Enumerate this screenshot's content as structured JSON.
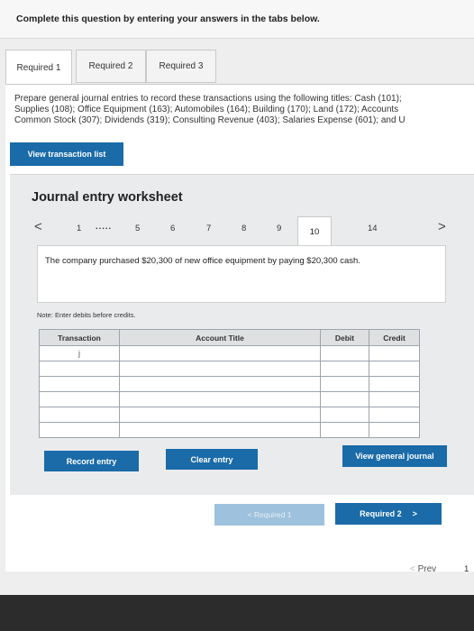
{
  "header": {
    "instruction": "Complete this question by entering your answers in the tabs below."
  },
  "tabs": [
    {
      "label": "Required 1",
      "active": true
    },
    {
      "label": "Required 2",
      "active": false
    },
    {
      "label": "Required 3",
      "active": false
    }
  ],
  "instructions": "Prepare general journal entries to record these transactions using the following titles: Cash (101);\nSupplies (108); Office Equipment (163); Automobiles (164); Building (170); Land (172); Accounts\nCommon Stock (307); Dividends (319); Consulting Revenue (403); Salaries Expense (601); and U",
  "view_transaction_list": "View transaction list",
  "worksheet": {
    "title": "Journal entry worksheet",
    "prev_arrow": "<",
    "next_arrow": ">",
    "pages": {
      "p1": "1",
      "ellipsis": ".....",
      "p5": "5",
      "p6": "6",
      "p7": "7",
      "p8": "8",
      "p9": "9",
      "p10": "10",
      "p14": "14"
    },
    "description": "The company purchased $20,300 of new office equipment by paying $20,300 cash.",
    "note": "Note: Enter debits before credits.",
    "table": {
      "headers": {
        "transaction": "Transaction",
        "account_title": "Account Title",
        "debit": "Debit",
        "credit": "Credit"
      },
      "first_transaction": "j"
    },
    "record_entry": "Record entry",
    "clear_entry": "Clear entry",
    "view_general_journal": "View general journal"
  },
  "nav": {
    "prev_required": "< Required 1",
    "next_required": "Required 2",
    "next_arrow": ">",
    "prev": "Prev",
    "page": "1"
  },
  "colors": {
    "button_blue": "#1a6ba8",
    "disabled_blue": "#9ec2dd"
  }
}
